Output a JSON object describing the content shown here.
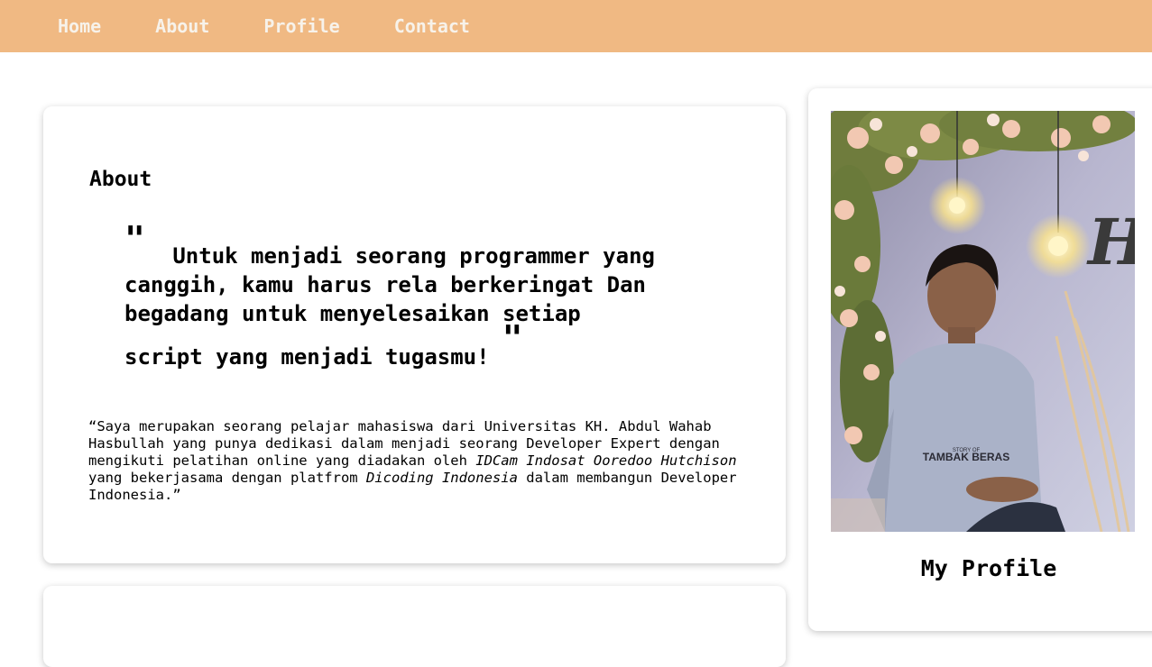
{
  "nav": {
    "items": [
      {
        "label": "Home"
      },
      {
        "label": "About"
      },
      {
        "label": "Profile"
      },
      {
        "label": "Contact"
      }
    ],
    "bg_color": "#f0b983",
    "text_color": "#f7f2ea"
  },
  "about": {
    "title": "About",
    "quote_open": "\"",
    "quote_close": "\"",
    "quote_lines": [
      "Untuk menjadi seorang programmer yang",
      "canggih, kamu harus rela berkeringat Dan",
      "begadang untuk menyelesaikan setiap",
      "script yang menjadi tugasmu!"
    ],
    "bio_part1": "“Saya merupakan seorang pelajar mahasiswa dari Universitas KH. Abdul Wahab Hasbullah yang punya dedikasi dalam menjadi seorang Developer Expert dengan mengikuti pelatihan online yang diadakan oleh ",
    "bio_em1": "IDCam Indosat Ooredoo Hutchison",
    "bio_part2": " yang bekerjasama dengan platfrom ",
    "bio_em2": "Dicoding Indonesia",
    "bio_part3": " dalam membangun Developer Indonesia.”"
  },
  "profile": {
    "caption": "My Profile",
    "shirt_text": "TAMBAK BERAS",
    "shirt_small": "STORY OF",
    "wall_sign": "Hu"
  }
}
